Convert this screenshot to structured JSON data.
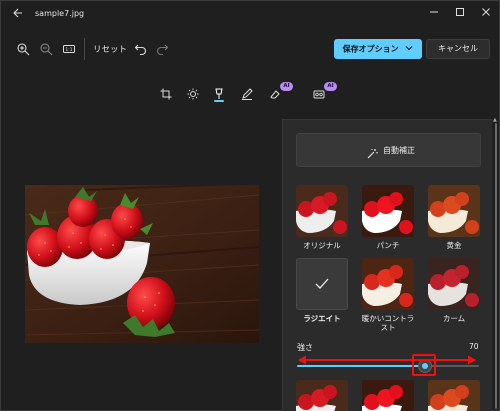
{
  "window": {
    "title": "sample7.jpg"
  },
  "toolbar": {
    "reset_label": "リセット",
    "save_label": "保存オプション",
    "cancel_label": "キャンセル"
  },
  "tools": {
    "ai_badge_1": "AI",
    "ai_badge_2": "AI"
  },
  "panel": {
    "auto_enhance_label": "自動補正",
    "filters": [
      {
        "label": "オリジナル"
      },
      {
        "label": "パンチ"
      },
      {
        "label": "黄金"
      },
      {
        "label": "ラジエイト"
      },
      {
        "label": "暖かいコントラスト"
      },
      {
        "label": "カーム"
      }
    ],
    "strength_label": "強さ",
    "strength_value": "70"
  },
  "colors": {
    "accent": "#60cdff",
    "annotation_red": "#e11111",
    "ai_badge": "#b88cf3"
  }
}
